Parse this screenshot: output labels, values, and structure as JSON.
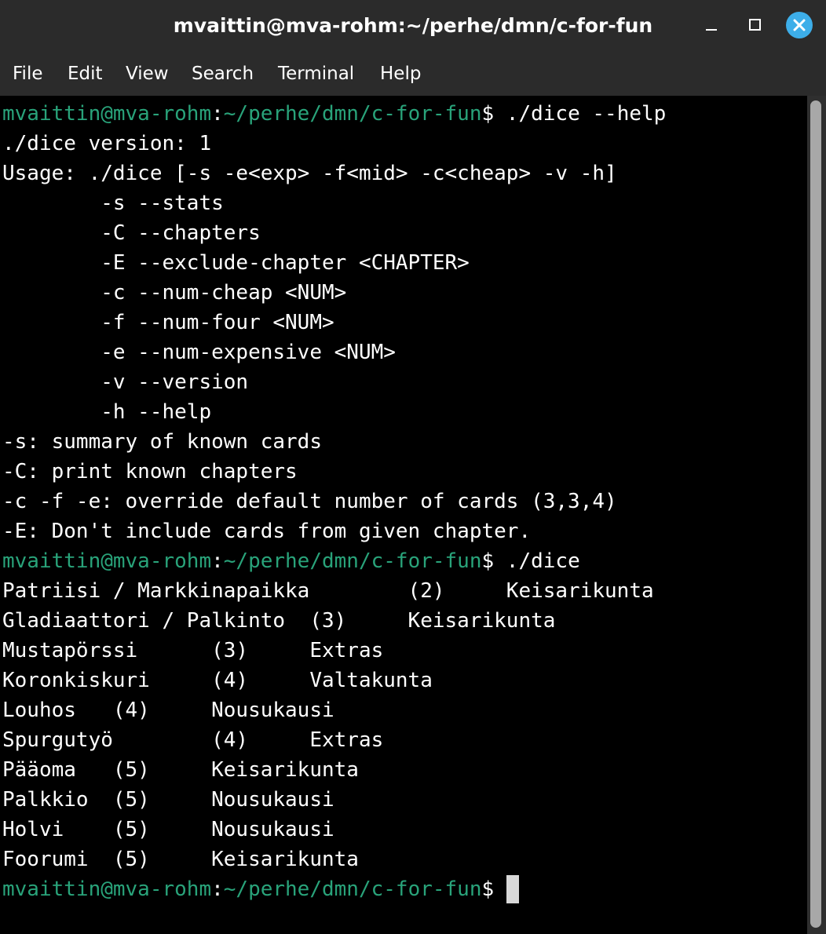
{
  "window": {
    "title": "mvaittin@mva-rohm:~/perhe/dmn/c-for-fun",
    "close_color": "#3daee9"
  },
  "menu": {
    "items": [
      "File",
      "Edit",
      "View",
      "Search",
      "Terminal",
      "Help"
    ]
  },
  "terminal": {
    "prompt": {
      "user_host": "mvaittin@mva-rohm",
      "colon": ":",
      "path": "~/perhe/dmn/c-for-fun",
      "dollar": "$"
    },
    "lines": [
      {
        "type": "prompt",
        "command": " ./dice --help"
      },
      {
        "type": "out",
        "text": "./dice version: 1"
      },
      {
        "type": "out",
        "text": "Usage: ./dice [-s -e<exp> -f<mid> -c<cheap> -v -h]"
      },
      {
        "type": "out",
        "text": "        -s --stats"
      },
      {
        "type": "out",
        "text": "        -C --chapters"
      },
      {
        "type": "out",
        "text": "        -E --exclude-chapter <CHAPTER>"
      },
      {
        "type": "out",
        "text": "        -c --num-cheap <NUM>"
      },
      {
        "type": "out",
        "text": "        -f --num-four <NUM>"
      },
      {
        "type": "out",
        "text": "        -e --num-expensive <NUM>"
      },
      {
        "type": "out",
        "text": "        -v --version"
      },
      {
        "type": "out",
        "text": "        -h --help"
      },
      {
        "type": "out",
        "text": "-s: summary of known cards"
      },
      {
        "type": "out",
        "text": "-C: print known chapters"
      },
      {
        "type": "out",
        "text": "-c -f -e: override default number of cards (3,3,4)"
      },
      {
        "type": "out",
        "text": "-E: Don't include cards from given chapter."
      },
      {
        "type": "prompt",
        "command": " ./dice"
      },
      {
        "type": "out",
        "text": "Patriisi / Markkinapaikka        (2)     Keisarikunta"
      },
      {
        "type": "out",
        "text": "Gladiaattori / Palkinto  (3)     Keisarikunta"
      },
      {
        "type": "out",
        "text": "Mustapörssi      (3)     Extras"
      },
      {
        "type": "out",
        "text": "Koronkiskuri     (4)     Valtakunta"
      },
      {
        "type": "out",
        "text": "Louhos   (4)     Nousukausi"
      },
      {
        "type": "out",
        "text": "Spurgutyö        (4)     Extras"
      },
      {
        "type": "out",
        "text": "Pääoma   (5)     Keisarikunta"
      },
      {
        "type": "out",
        "text": "Palkkio  (5)     Nousukausi"
      },
      {
        "type": "out",
        "text": "Holvi    (5)     Nousukausi"
      },
      {
        "type": "out",
        "text": "Foorumi  (5)     Keisarikunta"
      },
      {
        "type": "prompt",
        "command": " ",
        "cursor": true
      }
    ]
  }
}
